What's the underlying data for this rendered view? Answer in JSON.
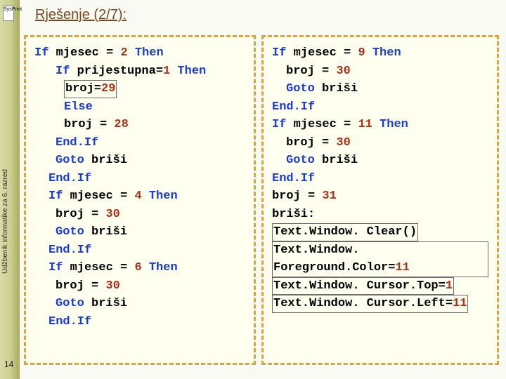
{
  "sidebar": {
    "vertical_label": "Udžbenik informatike za 6. razred",
    "badge": "SysPrint",
    "page_number": "14"
  },
  "header": {
    "title": "Rješenje (2/7):"
  },
  "code_left": {
    "l1a": "If",
    "l1b": " mjesec = ",
    "l1c": "2",
    "l1d": " Then",
    "l2a": "If",
    "l2b": " prijestupna=",
    "l2c": "1",
    "l2d": " Then",
    "l3a": "broj=",
    "l3b": "29",
    "l4a": "Else",
    "l5a": "broj = ",
    "l5b": "28",
    "l6a": "End.If",
    "l7a": "Goto",
    "l7b": " briši",
    "l8a": "End.If",
    "l9a": "If",
    "l9b": " mjesec = ",
    "l9c": "4",
    "l9d": " Then",
    "l10a": "broj = ",
    "l10b": "30",
    "l11a": "Goto",
    "l11b": " briši",
    "l12a": "End.If",
    "l13a": "If",
    "l13b": " mjesec = ",
    "l13c": "6",
    "l13d": " Then",
    "l14a": "broj = ",
    "l14b": "30",
    "l15a": "Goto",
    "l15b": " briši",
    "l16a": "End.If"
  },
  "code_right": {
    "l1a": "If",
    "l1b": " mjesec = ",
    "l1c": "9",
    "l1d": " Then",
    "l2a": "broj = ",
    "l2b": "30",
    "l3a": "Goto",
    "l3b": " briši",
    "l4a": "End.If",
    "l5a": "If",
    "l5b": " mjesec = ",
    "l5c": "11",
    "l5d": " Then",
    "l6a": "broj = ",
    "l6b": "30",
    "l7a": "Goto",
    "l7b": " briši",
    "l8a": "End.If",
    "l9a": "broj = ",
    "l9b": "31",
    "l10a": "briši:",
    "l11a": "Text.Window. Clear()",
    "l12a": "Text.Window. Foreground.Color=",
    "l12b": "11",
    "l13a": "Text.Window. Cursor.Top=",
    "l13b": "1",
    "l14a": "Text.Window. Cursor.Left=",
    "l14b": "11"
  }
}
